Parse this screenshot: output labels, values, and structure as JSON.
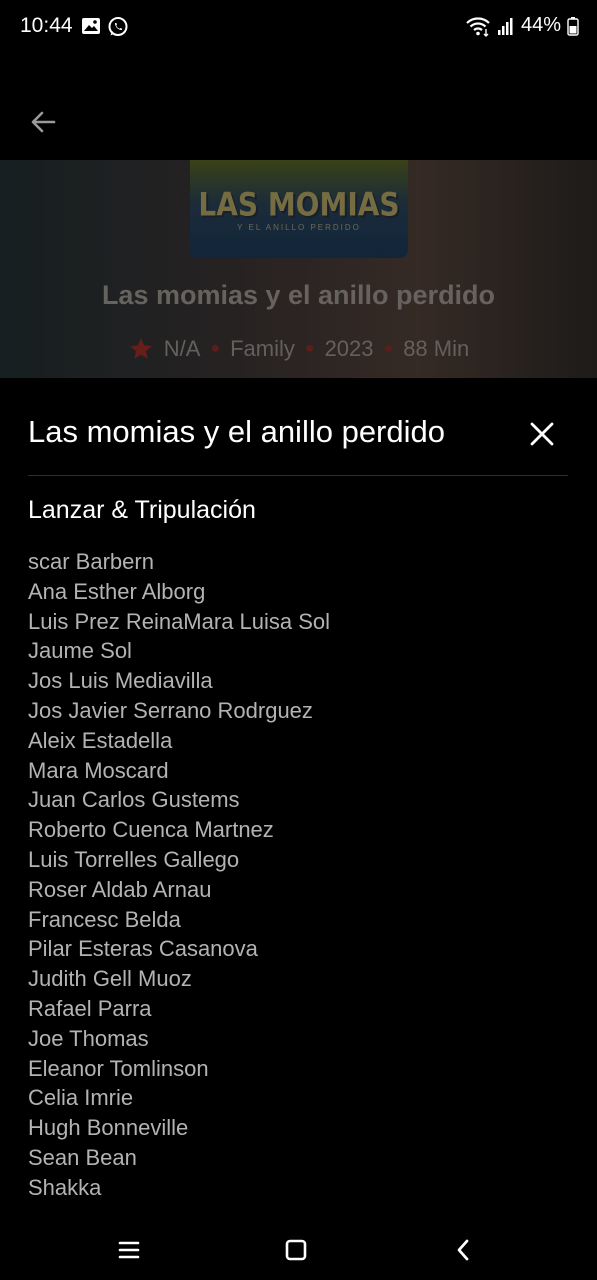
{
  "status_bar": {
    "time": "10:44",
    "battery": "44%",
    "icons": [
      "gallery-icon",
      "whatsapp-icon",
      "wifi-icon",
      "signal-icon",
      "battery-icon"
    ]
  },
  "hero": {
    "poster_title": "LAS MOMIAS",
    "poster_subtitle": "Y EL ANILLO PERDIDO",
    "title": "Las momias y el anillo perdido",
    "rating": "N/A",
    "genre": "Family",
    "year": "2023",
    "duration": "88 Min",
    "accent_color": "#c0312b"
  },
  "sheet": {
    "title": "Las momias y el anillo perdido",
    "section_heading": "Lanzar & Tripulación",
    "cast": [
      "scar Barbern",
      "Ana Esther Alborg",
      "Luis Prez ReinaMara Luisa Sol",
      "Jaume Sol",
      "Jos Luis Mediavilla",
      "Jos Javier Serrano Rodrguez",
      "Aleix Estadella",
      "Mara Moscard",
      "Juan Carlos Gustems",
      "Roberto Cuenca Martnez",
      "Luis Torrelles Gallego",
      "Roser Aldab Arnau",
      "Francesc Belda",
      "Pilar Esteras Casanova",
      "Judith Gell Muoz",
      "Rafael Parra",
      "Joe Thomas",
      "Eleanor Tomlinson",
      "Celia Imrie",
      "Hugh Bonneville",
      "Sean Bean",
      "Shakka"
    ]
  }
}
